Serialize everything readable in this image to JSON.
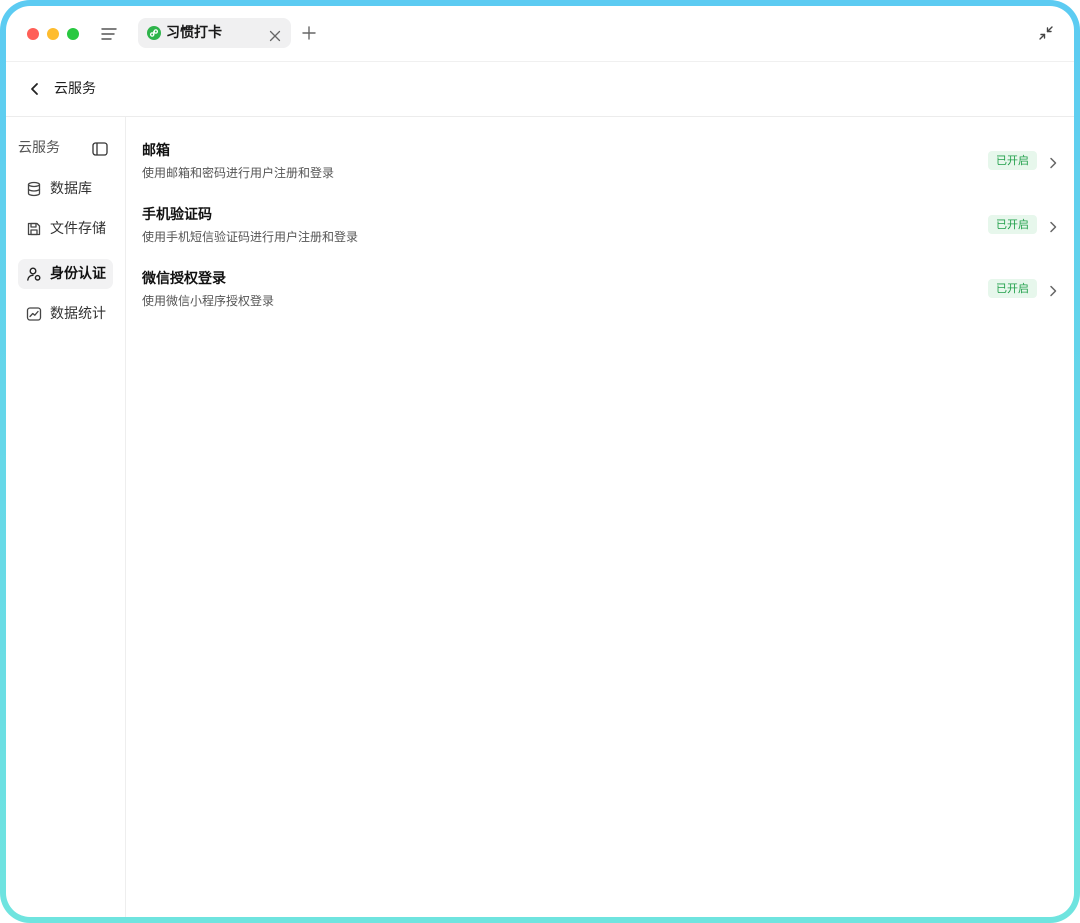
{
  "tab": {
    "title": "习惯打卡",
    "icon": "miniprogram-icon"
  },
  "header": {
    "title": "云服务",
    "back_icon": "chevron-left-icon"
  },
  "sidebar": {
    "title": "云服务",
    "items": [
      {
        "label": "数据库",
        "icon": "database-icon",
        "active": false
      },
      {
        "label": "文件存储",
        "icon": "save-icon",
        "active": false
      },
      {
        "label": "身份认证",
        "icon": "user-auth-icon",
        "active": true
      },
      {
        "label": "数据统计",
        "icon": "chart-icon",
        "active": false
      }
    ]
  },
  "services": [
    {
      "title": "邮箱",
      "description": "使用邮箱和密码进行用户注册和登录",
      "status": "已开启"
    },
    {
      "title": "手机验证码",
      "description": "使用手机短信验证码进行用户注册和登录",
      "status": "已开启"
    },
    {
      "title": "微信授权登录",
      "description": "使用微信小程序授权登录",
      "status": "已开启"
    }
  ],
  "colors": {
    "accent_green": "#22a04b",
    "badge_bg": "#e7f7ec",
    "frame_gradient_top": "#5ccbf2",
    "frame_gradient_bottom": "#6fe4df"
  }
}
